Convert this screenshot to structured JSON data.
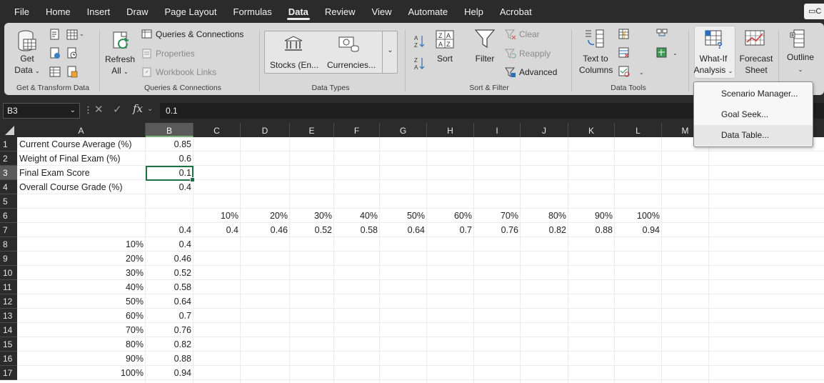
{
  "menu": {
    "tabs": [
      "File",
      "Home",
      "Insert",
      "Draw",
      "Page Layout",
      "Formulas",
      "Data",
      "Review",
      "View",
      "Automate",
      "Help",
      "Acrobat"
    ],
    "active_tab": "Data",
    "comment_label": "C"
  },
  "ribbon": {
    "get_transform": {
      "get_data_label": "Get\nData",
      "group_label": "Get & Transform Data"
    },
    "queries": {
      "refresh_all_label": "Refresh\nAll",
      "queries_connections": "Queries & Connections",
      "properties": "Properties",
      "workbook_links": "Workbook Links",
      "group_label": "Queries & Connections"
    },
    "data_types": {
      "stocks": "Stocks (En...",
      "currencies": "Currencies...",
      "group_label": "Data Types"
    },
    "sort_filter": {
      "sort": "Sort",
      "filter": "Filter",
      "clear": "Clear",
      "reapply": "Reapply",
      "advanced": "Advanced",
      "group_label": "Sort & Filter"
    },
    "data_tools": {
      "text_to_columns": "Text to\nColumns",
      "group_label": "Data Tools"
    },
    "forecast": {
      "what_if": "What-If\nAnalysis",
      "forecast_sheet": "Forecast\nSheet"
    },
    "outline": {
      "label": "Outline"
    }
  },
  "what_if_menu": {
    "items": [
      "Scenario Manager...",
      "Goal Seek...",
      "Data Table..."
    ],
    "hovered_index": 2
  },
  "formula_bar": {
    "name_box": "B3",
    "fx_label": "fx",
    "value": "0.1"
  },
  "columns": [
    "A",
    "B",
    "C",
    "D",
    "E",
    "F",
    "G",
    "H",
    "I",
    "J",
    "K",
    "L",
    "M"
  ],
  "selected_column": "B",
  "selected_row": 3,
  "rows": [
    {
      "n": "1",
      "a": "Current Course Average (%)",
      "b": "0.85"
    },
    {
      "n": "2",
      "a": "Weight of Final Exam (%)",
      "b": "0.6"
    },
    {
      "n": "3",
      "a": "Final Exam Score",
      "b": "0.1"
    },
    {
      "n": "4",
      "a": "Overall Course Grade (%)",
      "b": "0.4"
    },
    {
      "n": "5",
      "a": "",
      "b": ""
    },
    {
      "n": "6",
      "a": "",
      "b": ""
    },
    {
      "n": "7",
      "a": "",
      "b": "0.4"
    },
    {
      "n": "8",
      "a": "10%",
      "b": "0.4"
    },
    {
      "n": "9",
      "a": "20%",
      "b": "0.46"
    },
    {
      "n": "10",
      "a": "30%",
      "b": "0.52"
    },
    {
      "n": "11",
      "a": "40%",
      "b": "0.58"
    },
    {
      "n": "12",
      "a": "50%",
      "b": "0.64"
    },
    {
      "n": "13",
      "a": "60%",
      "b": "0.7"
    },
    {
      "n": "14",
      "a": "70%",
      "b": "0.76"
    },
    {
      "n": "15",
      "a": "80%",
      "b": "0.82"
    },
    {
      "n": "16",
      "a": "90%",
      "b": "0.88"
    },
    {
      "n": "17",
      "a": "100%",
      "b": "0.94"
    }
  ],
  "row6_headers": [
    "10%",
    "20%",
    "30%",
    "40%",
    "50%",
    "60%",
    "70%",
    "80%",
    "90%",
    "100%"
  ],
  "row7_values": [
    "0.4",
    "0.46",
    "0.52",
    "0.58",
    "0.64",
    "0.7",
    "0.76",
    "0.82",
    "0.88",
    "0.94"
  ]
}
